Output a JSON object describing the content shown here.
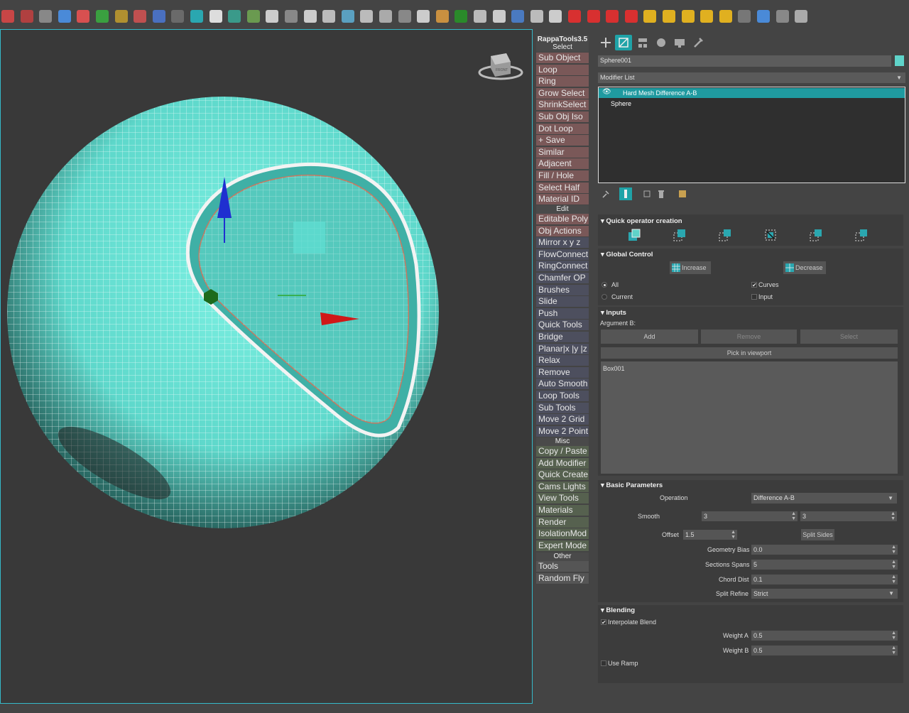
{
  "rappa": {
    "title": "RappaTools3.5",
    "section_select": "Select",
    "select_items": [
      "Sub Object",
      "Loop",
      "Ring",
      "Grow Select",
      "ShrinkSelect",
      "Sub Obj Iso",
      "Dot Loop",
      "+ Save",
      "Similar",
      "Adjacent",
      "Fill / Hole",
      "Select Half",
      "Material ID"
    ],
    "section_edit": "Edit",
    "edit_items": [
      "Editable Poly",
      "Obj Actions",
      "Mirror  x  y  z",
      "FlowConnect",
      "RingConnect",
      "Chamfer OP",
      "Brushes",
      "Slide",
      "Push",
      "Quick Tools",
      "Bridge",
      "Planar|x |y |z",
      "Relax",
      "Remove",
      "Auto Smooth",
      "Loop Tools",
      "Sub Tools",
      "Move 2 Grid",
      "Move 2 Point"
    ],
    "section_misc": "Misc",
    "misc_items": [
      "Copy / Paste",
      "Add Modifier",
      "Quick Create",
      "Cams Lights",
      "View Tools",
      "Materials",
      "Render",
      "IsolationMod",
      "Expert Mode"
    ],
    "section_other": "Other",
    "other_items": [
      "Tools",
      "Random Fly"
    ]
  },
  "viewcube": {
    "label": "FRONT"
  },
  "cmd": {
    "object_name": "Sphere001",
    "object_color": "#5fd3c9",
    "modifier_list": "Modifier List",
    "stack": [
      "Hard Mesh Difference A-B",
      "Sphere"
    ],
    "quick_operator": {
      "title": "Quick operator creation"
    },
    "global_control": {
      "title": "Global Control",
      "increase": "Increase",
      "decrease": "Decrease",
      "all": "All",
      "current": "Current",
      "curves": "Curves",
      "input": "Input"
    },
    "inputs": {
      "title": "Inputs",
      "argument_b": "Argument B:",
      "add": "Add",
      "remove": "Remove",
      "select": "Select",
      "pick": "Pick in viewport",
      "list": [
        "Box001"
      ]
    },
    "basic": {
      "title": "Basic Parameters",
      "operation_label": "Operation",
      "operation_value": "Difference A-B",
      "smooth_label": "Smooth",
      "smooth_a": "3",
      "smooth_b": "3",
      "offset_label": "Offset",
      "offset_value": "1.5",
      "split_sides": "Split Sides",
      "geometry_bias_label": "Geometry Bias",
      "geometry_bias_value": "0.0",
      "sections_spans_label": "Sections Spans",
      "sections_spans_value": "5",
      "chord_dist_label": "Chord Dist",
      "chord_dist_value": "0.1",
      "split_refine_label": "Split Refine",
      "split_refine_value": "Strict"
    },
    "blending": {
      "title": "Blending",
      "interpolate": "Interpolate Blend",
      "weight_a_label": "Weight A",
      "weight_a_value": "0.5",
      "weight_b_label": "Weight B",
      "weight_b_value": "0.5",
      "use_ramp": "Use Ramp"
    }
  },
  "colors": {
    "accent": "#1fa3a8",
    "selection": "#1f9aa0",
    "mesh": "#6ee6d8"
  }
}
